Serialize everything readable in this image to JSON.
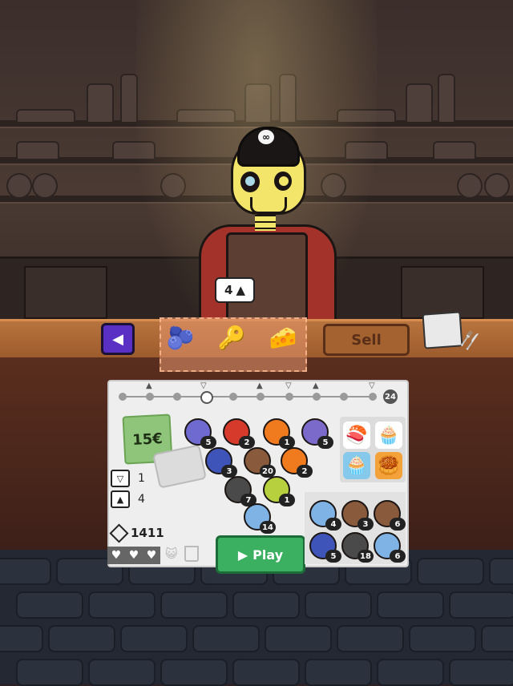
{
  "shopkeeper": {
    "price_value": "4"
  },
  "counter": {
    "back_icon": "triangle-left-icon",
    "tray_items": [
      "blackberry-icon",
      "lime-key-icon",
      "cheese-icon"
    ],
    "sell_label": "Sell"
  },
  "panel": {
    "progress_badge": "24",
    "money": "15€",
    "stats": [
      {
        "icon": "cocktail-ticket-icon",
        "value": "1"
      },
      {
        "icon": "cake-ticket-icon",
        "value": "4"
      }
    ],
    "gems": "1411",
    "play_label": "Play",
    "triangle_balls": [
      {
        "count": "5",
        "color": "#6e6ad0"
      },
      {
        "count": "2",
        "color": "#d63a2b"
      },
      {
        "count": "1",
        "color": "#f07a1e"
      },
      {
        "count": "5",
        "color": "#7c6acb"
      },
      {
        "count": "3",
        "color": "#3f54b8"
      },
      {
        "count": "20",
        "color": "#8a5a3c"
      },
      {
        "count": "2",
        "color": "#f07a1e"
      },
      {
        "count": "7",
        "color": "#4a4a4a"
      },
      {
        "count": "1",
        "color": "#b7d13e"
      },
      {
        "count": "14",
        "color": "#7fb3e6"
      }
    ],
    "reserve_balls": [
      {
        "count": "4",
        "color": "#7fb3e6"
      },
      {
        "count": "3",
        "color": "#8a5a3c"
      },
      {
        "count": "6",
        "color": "#8a5a3c"
      },
      {
        "count": "5",
        "color": "#3f54b8"
      },
      {
        "count": "18",
        "color": "#4a4a4a"
      },
      {
        "count": "6",
        "color": "#7fb3e6"
      }
    ]
  }
}
